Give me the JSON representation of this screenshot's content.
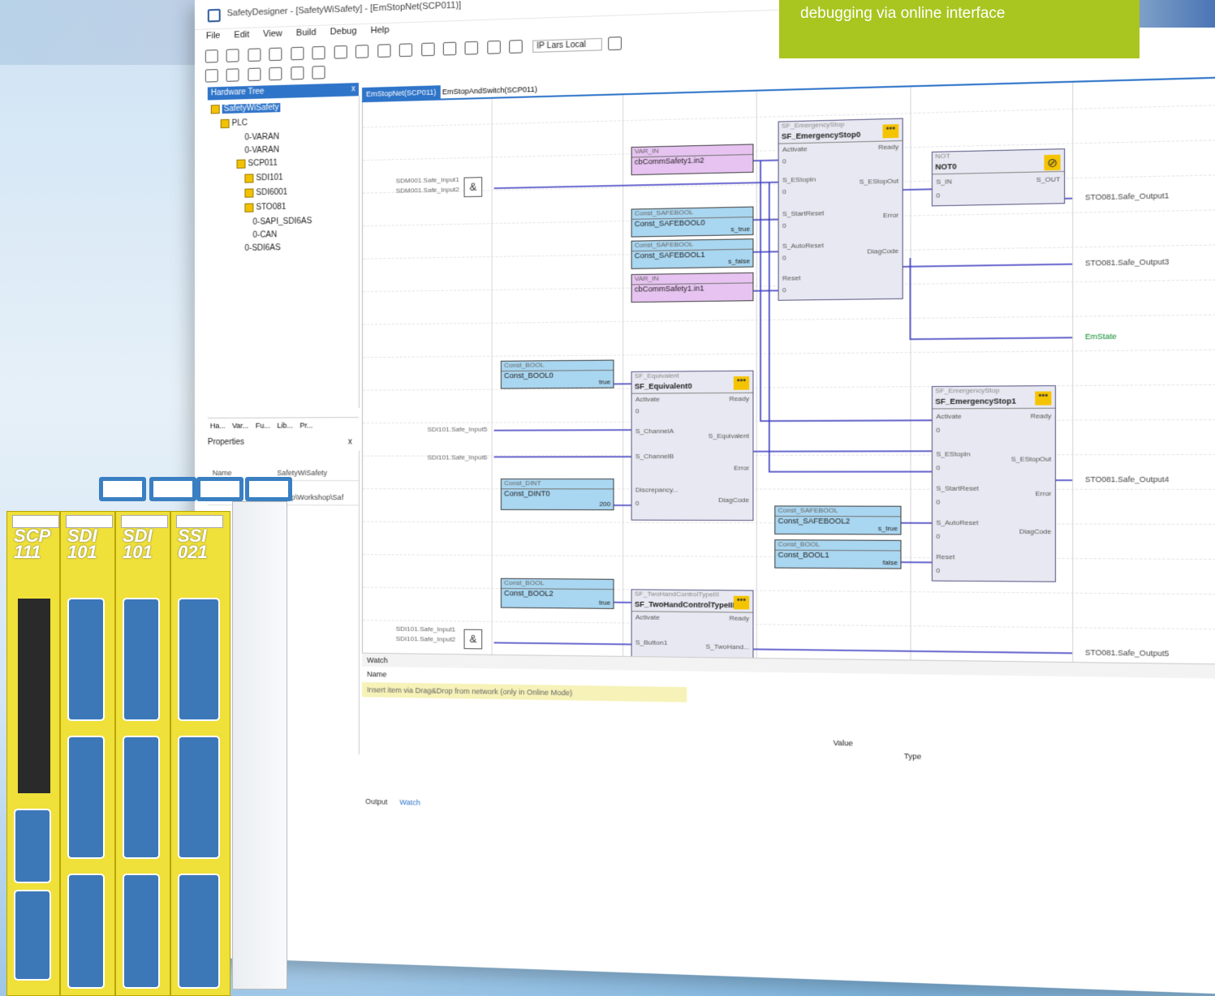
{
  "callout": {
    "text": "debugging via online interface"
  },
  "window": {
    "title": "SafetyDesigner - [SafetyWiSafety] - [EmStopNet(SCP011)]"
  },
  "menu": [
    "File",
    "Edit",
    "View",
    "Build",
    "Debug",
    "Help"
  ],
  "toolbar": {
    "ip_select": "IP Lars Local"
  },
  "hardware_tree": {
    "title": "Hardware Tree",
    "close": "x",
    "nodes": [
      "SafetyWiSafety",
      "PLC",
      "0-VARAN",
      "0-VARAN",
      "SCP011",
      "SDI101",
      "SDI6001",
      "STO081",
      "0-SAPI_SDI6AS",
      "0-CAN",
      "0-SDI6AS"
    ]
  },
  "panel_tabs": [
    "Ha...",
    "Var...",
    "Fu...",
    "Lib...",
    "Pr..."
  ],
  "properties": {
    "title": "Properties",
    "close": "x",
    "name_label": "Name",
    "name_value": "SafetyWiSafety",
    "path_value": "...app\\Workshop\\Saf"
  },
  "doc_tabs": [
    "EmStopNet(SCP011)",
    "EmStopAndSwitch(SCP011)"
  ],
  "blocks": {
    "estop0": {
      "type": "SF_EmergencyStop",
      "name": "SF_EmergencyStop0",
      "inputs": [
        "Activate",
        "S_EStopIn",
        "S_StartReset",
        "S_AutoReset",
        "Reset"
      ],
      "outputs": [
        "Ready",
        "S_EStopOut",
        "Error",
        "DiagCode"
      ]
    },
    "not0": {
      "type": "NOT",
      "name": "NOT0",
      "input": "S_IN",
      "output": "S_OUT"
    },
    "equiv0": {
      "type": "SF_Equivalent",
      "name": "SF_Equivalent0",
      "inputs": [
        "Activate",
        "S_ChannelA",
        "S_ChannelB",
        "Discrepancy..."
      ],
      "outputs": [
        "Ready",
        "S_Equivalent",
        "Error",
        "DiagCode"
      ]
    },
    "estop1": {
      "type": "SF_EmergencyStop",
      "name": "SF_EmergencyStop1",
      "inputs": [
        "Activate",
        "S_EStopIn",
        "S_StartReset",
        "S_AutoReset",
        "Reset"
      ],
      "outputs": [
        "Ready",
        "S_EStopOut",
        "Error",
        "DiagCode"
      ]
    },
    "twohand0": {
      "type": "SF_TwoHandControlTypeIII",
      "name": "SF_TwoHandControlTypeIII0",
      "inputs": [
        "Activate",
        "S_Button1"
      ],
      "outputs": [
        "Ready",
        "S_TwoHand..."
      ]
    }
  },
  "vars": {
    "v1": {
      "type": "VAR_IN",
      "name": "cbCommSafety1.in2"
    },
    "v2": {
      "type": "Const_SAFEBOOL",
      "name": "Const_SAFEBOOL0",
      "value": "s_true"
    },
    "v3": {
      "type": "Const_SAFEBOOL",
      "name": "Const_SAFEBOOL1",
      "value": "s_false"
    },
    "v4": {
      "type": "VAR_IN",
      "name": "cbCommSafety1.in1"
    },
    "v5": {
      "type": "Const_BOOL",
      "name": "Const_BOOL0",
      "value": "true"
    },
    "v6": {
      "type": "Const_DINT",
      "name": "Const_DINT0",
      "value": "200"
    },
    "v7": {
      "type": "Const_SAFEBOOL",
      "name": "Const_SAFEBOOL2",
      "value": "s_true"
    },
    "v8": {
      "type": "Const_BOOL",
      "name": "Const_BOOL1",
      "value": "false"
    },
    "v9": {
      "type": "Const_BOOL",
      "name": "Const_BOOL2",
      "value": "true"
    }
  },
  "gate_symbol": "&",
  "pin_zero": "0",
  "dots_symbol": "•••",
  "not_symbol": "⊘",
  "inputs": [
    "SDM001.Safe_Input1",
    "SDM001.Safe_Input2",
    "SDI101.Safe_Input5",
    "SDI101.Safe_Input6",
    "SDI101.Safe_Input1",
    "SDI101.Safe_Input2"
  ],
  "outputs": [
    "STO081.Safe_Output1",
    "STO081.Safe_Output3",
    "EmState",
    "STO081.Safe_Output4",
    "STO081.Safe_Output5"
  ],
  "watch": {
    "title": "Watch",
    "name_col": "Name",
    "hint": "Insert item via Drag&Drop from network (only in Online Mode)",
    "value_col": "Value",
    "type_col": "Type"
  },
  "bottom_tabs": [
    "Output",
    "Watch"
  ],
  "device": {
    "modules": [
      "SCP 111",
      "SDI 101",
      "SDI 101",
      "SSI 021"
    ]
  },
  "colors": {
    "accent": "#2e74c9",
    "callout": "#a8c520",
    "wire": "#3c3cc0",
    "module": "#efe03a"
  }
}
